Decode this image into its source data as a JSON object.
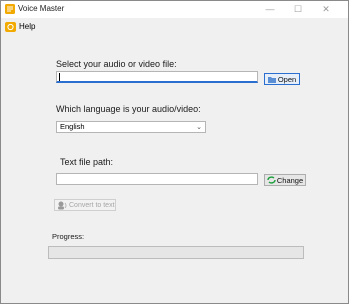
{
  "window": {
    "title": "Voice Master",
    "controls": {
      "minimize": "—",
      "maximize": "☐",
      "close": "✕"
    }
  },
  "menu": {
    "help_label": "Help"
  },
  "file_section": {
    "label": "Select your audio or video file:",
    "value": "",
    "open_button_label": "Open"
  },
  "language_section": {
    "label": "Which language is your audio/video:",
    "selected": "English"
  },
  "text_section": {
    "label": "Text file path:",
    "value": "",
    "change_button_label": "Change"
  },
  "convert_button_label": "Convert to text",
  "progress": {
    "label": "Progress:",
    "value_fraction": 0
  },
  "colors": {
    "accent": "#2a6fcf",
    "help_icon": "#f2a900",
    "change_icon": "#1a9e3a"
  }
}
